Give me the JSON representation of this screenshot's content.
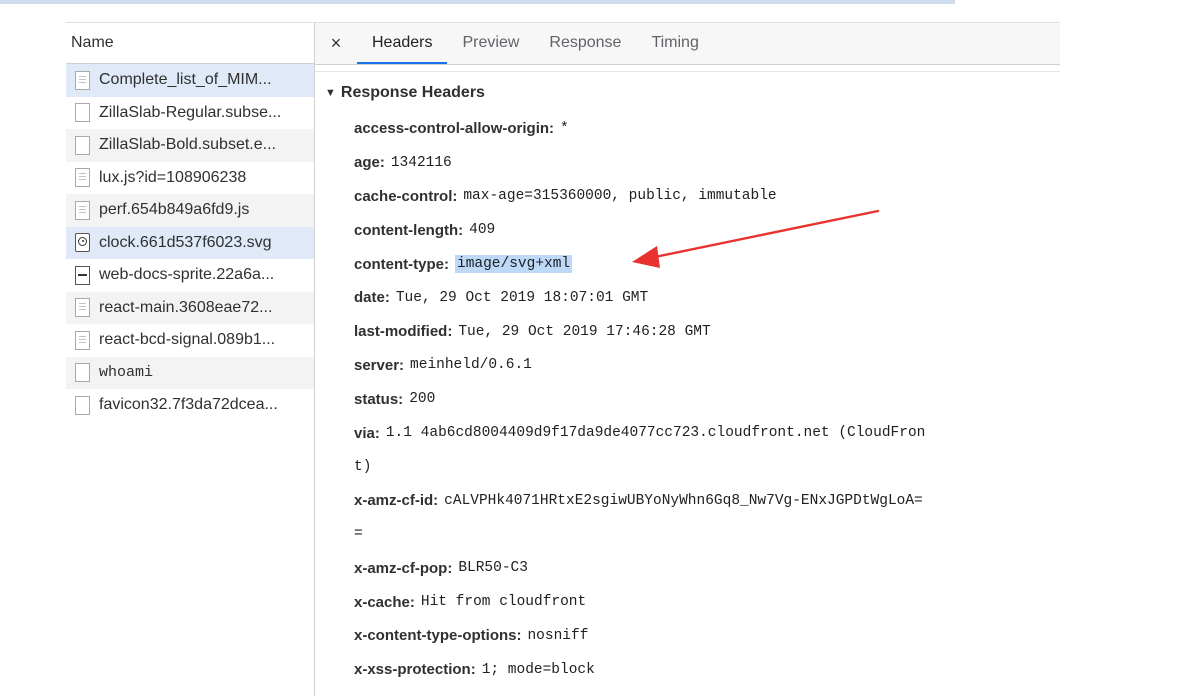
{
  "name_panel": {
    "header": "Name",
    "requests": [
      {
        "label": "Complete_list_of_MIM...",
        "icon": "document-icon",
        "icon_class": "doc",
        "style": "selected"
      },
      {
        "label": "ZillaSlab-Regular.subse...",
        "icon": "file-icon",
        "icon_class": "blank",
        "style": ""
      },
      {
        "label": "ZillaSlab-Bold.subset.e...",
        "icon": "file-icon",
        "icon_class": "blank",
        "style": "alt"
      },
      {
        "label": "lux.js?id=108906238",
        "icon": "script-icon",
        "icon_class": "script",
        "style": ""
      },
      {
        "label": "perf.654b849a6fd9.js",
        "icon": "script-icon",
        "icon_class": "script",
        "style": "alt"
      },
      {
        "label": "clock.661d537f6023.svg",
        "icon": "image-icon",
        "icon_class": "img",
        "style": "selected"
      },
      {
        "label": "web-docs-sprite.22a6a...",
        "icon": "sprite-icon",
        "icon_class": "sprite",
        "style": ""
      },
      {
        "label": "react-main.3608eae72...",
        "icon": "script-icon",
        "icon_class": "script",
        "style": "alt"
      },
      {
        "label": "react-bcd-signal.089b1...",
        "icon": "script-icon",
        "icon_class": "script",
        "style": ""
      },
      {
        "label": "whoami",
        "icon": "file-icon",
        "icon_class": "blank",
        "style": "alt",
        "mono": true
      },
      {
        "label": "favicon32.7f3da72dcea...",
        "icon": "file-icon",
        "icon_class": "blank",
        "style": ""
      }
    ]
  },
  "details": {
    "close_glyph": "×",
    "tabs": [
      {
        "label": "Headers",
        "active": true
      },
      {
        "label": "Preview",
        "active": false
      },
      {
        "label": "Response",
        "active": false
      },
      {
        "label": "Timing",
        "active": false
      }
    ],
    "section_title": "Response Headers",
    "section_toggle": "▼",
    "headers": [
      {
        "key": "access-control-allow-origin:",
        "value": "*"
      },
      {
        "key": "age:",
        "value": "1342116"
      },
      {
        "key": "cache-control:",
        "value": "max-age=315360000, public, immutable"
      },
      {
        "key": "content-length:",
        "value": "409"
      },
      {
        "key": "content-type:",
        "value": "image/svg+xml",
        "highlight": true
      },
      {
        "key": "date:",
        "value": "Tue, 29 Oct 2019 18:07:01 GMT"
      },
      {
        "key": "last-modified:",
        "value": "Tue, 29 Oct 2019 17:46:28 GMT"
      },
      {
        "key": "server:",
        "value": "meinheld/0.6.1"
      },
      {
        "key": "status:",
        "value": "200"
      },
      {
        "key": "via:",
        "value": "1.1 4ab6cd8004409d9f17da9de4077cc723.cloudfront.net (CloudFron",
        "continuation": "t)"
      },
      {
        "key": "x-amz-cf-id:",
        "value": "cALVPHk4071HRtxE2sgiwUBYoNyWhn6Gq8_Nw7Vg-ENxJGPDtWgLoA=",
        "continuation": "="
      },
      {
        "key": "x-amz-cf-pop:",
        "value": "BLR50-C3"
      },
      {
        "key": "x-cache:",
        "value": "Hit from cloudfront"
      },
      {
        "key": "x-content-type-options:",
        "value": "nosniff"
      },
      {
        "key": "x-xss-protection:",
        "value": "1; mode=block"
      }
    ]
  },
  "annotation": {
    "arrow_color": "#e8322f"
  }
}
